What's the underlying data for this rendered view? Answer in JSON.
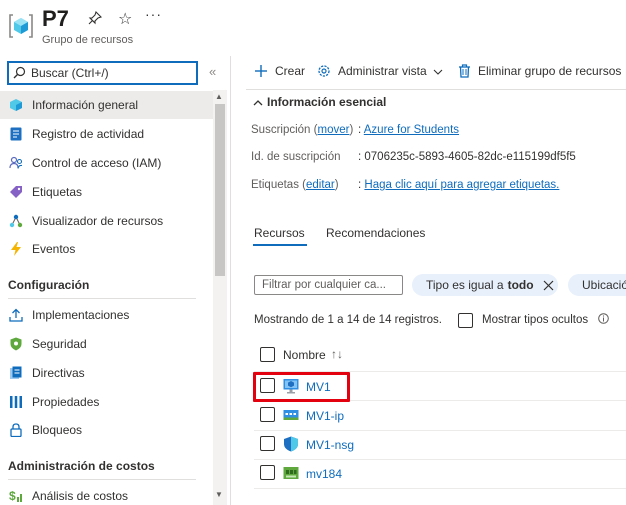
{
  "header": {
    "title": "P7",
    "subtitle": "Grupo de recursos"
  },
  "search": {
    "placeholder": "Buscar (Ctrl+/)",
    "collapse_glyph": "«"
  },
  "sidebar": {
    "items": [
      {
        "label": "Información general",
        "icon": "cube-icon",
        "active": true
      },
      {
        "label": "Registro de actividad",
        "icon": "activity-log-icon"
      },
      {
        "label": "Control de acceso (IAM)",
        "icon": "people-icon"
      },
      {
        "label": "Etiquetas",
        "icon": "tag-icon"
      },
      {
        "label": "Visualizador de recursos",
        "icon": "resource-visualizer-icon"
      },
      {
        "label": "Eventos",
        "icon": "lightning-icon"
      }
    ],
    "section_config": "Configuración",
    "config_items": [
      {
        "label": "Implementaciones",
        "icon": "upload-icon"
      },
      {
        "label": "Seguridad",
        "icon": "shield-icon"
      },
      {
        "label": "Directivas",
        "icon": "policy-icon"
      },
      {
        "label": "Propiedades",
        "icon": "properties-icon"
      },
      {
        "label": "Bloqueos",
        "icon": "lock-icon"
      }
    ],
    "section_cost": "Administración de costos",
    "cost_items": [
      {
        "label": "Análisis de costos",
        "icon": "dollar-icon"
      }
    ]
  },
  "toolbar": {
    "create": "Crear",
    "manage_view": "Administrar vista",
    "delete": "Eliminar grupo de recursos"
  },
  "essentials": {
    "header": "Información esencial",
    "subscription_label": "Suscripción",
    "subscription_move": "mover",
    "subscription_value": "Azure for Students",
    "subscription_id_label": "Id. de suscripción",
    "subscription_id_value": "0706235c-5893-4605-82dc-e115199df5f5",
    "tags_label": "Etiquetas",
    "tags_edit": "editar",
    "tags_value": "Haga clic aquí para agregar etiquetas."
  },
  "tabs": {
    "resources": "Recursos",
    "recommendations": "Recomendaciones"
  },
  "filters": {
    "placeholder": "Filtrar por cualquier ca...",
    "type_pill_prefix": "Tipo es igual a",
    "type_pill_value": "todo",
    "location_pill": "Ubicació"
  },
  "results": {
    "showing": "Mostrando de 1 a 14 de 14 registros.",
    "show_hidden": "Mostrar tipos ocultos"
  },
  "table": {
    "column_name": "Nombre",
    "rows": [
      {
        "name": "MV1",
        "icon": "virtual-machine-icon"
      },
      {
        "name": "MV1-ip",
        "icon": "public-ip-icon"
      },
      {
        "name": "MV1-nsg",
        "icon": "nsg-shield-icon"
      },
      {
        "name": "mv184",
        "icon": "network-interface-icon"
      }
    ]
  },
  "colors": {
    "accent": "#0f6cbd",
    "highlight": "#e3000f",
    "pill_bg": "#e8f0fb"
  }
}
